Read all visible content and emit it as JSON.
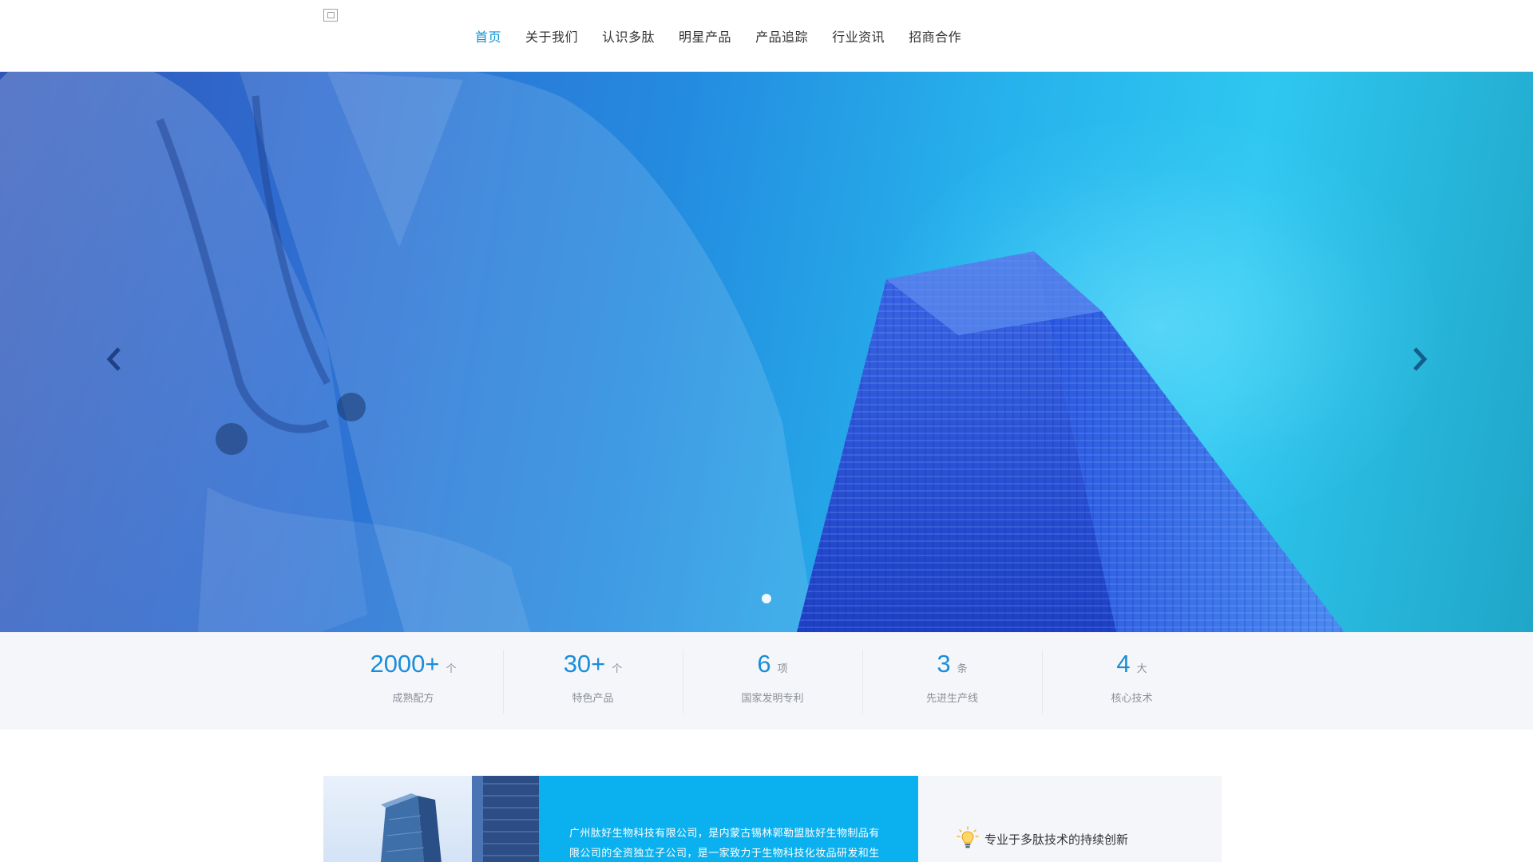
{
  "header": {
    "logo_icon": "broken-image-icon",
    "nav": [
      {
        "label": "首页",
        "active": true
      },
      {
        "label": "关于我们",
        "active": false
      },
      {
        "label": "认识多肽",
        "active": false
      },
      {
        "label": "明星产品",
        "active": false
      },
      {
        "label": "产品追踪",
        "active": false
      },
      {
        "label": "行业资讯",
        "active": false
      },
      {
        "label": "招商合作",
        "active": false
      }
    ],
    "active_color": "#0a96d8"
  },
  "hero": {
    "image_alt": "doctor-and-skyscraper-banner",
    "prev_icon": "chevron-left-icon",
    "next_icon": "chevron-right-icon",
    "slide_count": 1,
    "current_slide": 1
  },
  "stats": [
    {
      "value": "2000+",
      "unit": "个",
      "label": "成熟配方"
    },
    {
      "value": "30+",
      "unit": "个",
      "label": "特色产品"
    },
    {
      "value": "6",
      "unit": "项",
      "label": "国家发明专利"
    },
    {
      "value": "3",
      "unit": "条",
      "label": "先进生产线"
    },
    {
      "value": "4",
      "unit": "大",
      "label": "核心技术"
    }
  ],
  "intro": {
    "paragraph_lines": [
      "广州肽好生物科技有限公司，是内蒙古锡林郭勒盟肽好生物制品有",
      "限公司的全资独立子公司，是一家致力于生物科技化妆品研发和生"
    ],
    "slogan": "专业于多肽技术的持续创新",
    "slogan_icon": "lightbulb-icon"
  },
  "colors": {
    "accent": "#0a96d8",
    "stat_number": "#1a8ed9",
    "intro_panel": "#0bb0ee",
    "stats_bg": "#f5f6fa"
  }
}
